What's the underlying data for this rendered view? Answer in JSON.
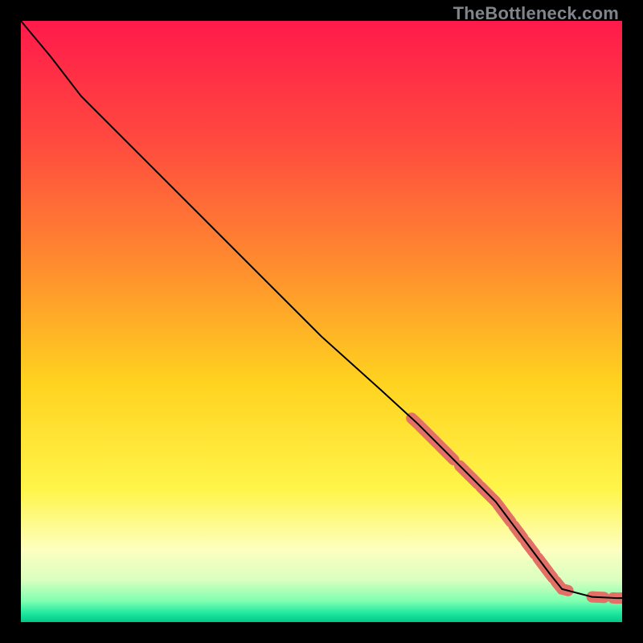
{
  "watermark": "TheBottleneck.com",
  "chart_data": {
    "type": "line",
    "title": "",
    "xlabel": "",
    "ylabel": "",
    "xlim": [
      0,
      100
    ],
    "ylim": [
      0,
      100
    ],
    "grid": false,
    "legend": false,
    "background_gradient": {
      "stops": [
        {
          "pos": 0.0,
          "color": "#ff1a4b"
        },
        {
          "pos": 0.2,
          "color": "#ff4a3f"
        },
        {
          "pos": 0.4,
          "color": "#ff8a2f"
        },
        {
          "pos": 0.6,
          "color": "#ffd21f"
        },
        {
          "pos": 0.78,
          "color": "#fff54a"
        },
        {
          "pos": 0.88,
          "color": "#fdffc0"
        },
        {
          "pos": 0.93,
          "color": "#d9ffc0"
        },
        {
          "pos": 0.965,
          "color": "#7fffb0"
        },
        {
          "pos": 0.985,
          "color": "#20e8a0"
        },
        {
          "pos": 1.0,
          "color": "#00c888"
        }
      ]
    },
    "curve": {
      "description": "Monotonically decreasing curve from top-left to bottom-right, roughly linear with a slight knee near (6,93) and flattening to y≈4 for x>95.",
      "points": [
        {
          "x": 0,
          "y": 100
        },
        {
          "x": 5,
          "y": 94
        },
        {
          "x": 10,
          "y": 87.5
        },
        {
          "x": 20,
          "y": 77.5
        },
        {
          "x": 30,
          "y": 67.5
        },
        {
          "x": 40,
          "y": 57.5
        },
        {
          "x": 50,
          "y": 47.5
        },
        {
          "x": 60,
          "y": 38.5
        },
        {
          "x": 66,
          "y": 33
        },
        {
          "x": 70,
          "y": 29
        },
        {
          "x": 75,
          "y": 24
        },
        {
          "x": 79,
          "y": 20
        },
        {
          "x": 82,
          "y": 16
        },
        {
          "x": 85,
          "y": 12
        },
        {
          "x": 88,
          "y": 8
        },
        {
          "x": 90,
          "y": 5.5
        },
        {
          "x": 95,
          "y": 4.2
        },
        {
          "x": 99,
          "y": 4.0
        },
        {
          "x": 100,
          "y": 4.0
        }
      ]
    },
    "markers": {
      "description": "Clusters of salmon-pink rounded segments over the line in the lower-right region",
      "color": "#e27066",
      "points": [
        {
          "x1": 65,
          "x2": 72
        },
        {
          "x1": 73,
          "x2": 76
        },
        {
          "x1": 76.5,
          "x2": 79
        },
        {
          "x1": 79.3,
          "x2": 81.5
        },
        {
          "x1": 82,
          "x2": 83.5
        },
        {
          "x1": 84,
          "x2": 85.5
        },
        {
          "x1": 86,
          "x2": 88.5
        },
        {
          "x1": 89,
          "x2": 91
        },
        {
          "x1": 95,
          "x2": 97
        },
        {
          "x1": 98.5,
          "x2": 100
        }
      ]
    }
  }
}
